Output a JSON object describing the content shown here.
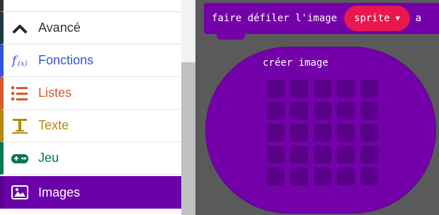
{
  "toolbox": {
    "categories": [
      {
        "label": "Avancé",
        "icon": "chevron-up-icon",
        "color": "#333333"
      },
      {
        "label": "Fonctions",
        "icon": "function-icon",
        "color": "#3455db"
      },
      {
        "label": "Listes",
        "icon": "list-icon",
        "color": "#d65a2a"
      },
      {
        "label": "Texte",
        "icon": "text-icon",
        "color": "#b8860b"
      },
      {
        "label": "Jeu",
        "icon": "gamepad-icon",
        "color": "#007a4b"
      },
      {
        "label": "Images",
        "icon": "image-icon",
        "color": "#ffffff",
        "selected": true,
        "background": "#6a00a8"
      }
    ]
  },
  "workspace": {
    "scroll_block": {
      "text": "faire défiler l'image",
      "dropdown_value": "sprite",
      "trailing_text": "a"
    },
    "create_image_block": {
      "title": "créer image",
      "grid_rows": 5,
      "grid_cols": 5
    },
    "colors": {
      "block": "#7300a8",
      "dropdown": "#e8184e",
      "workspace_bg": "#5a5a5a"
    }
  }
}
